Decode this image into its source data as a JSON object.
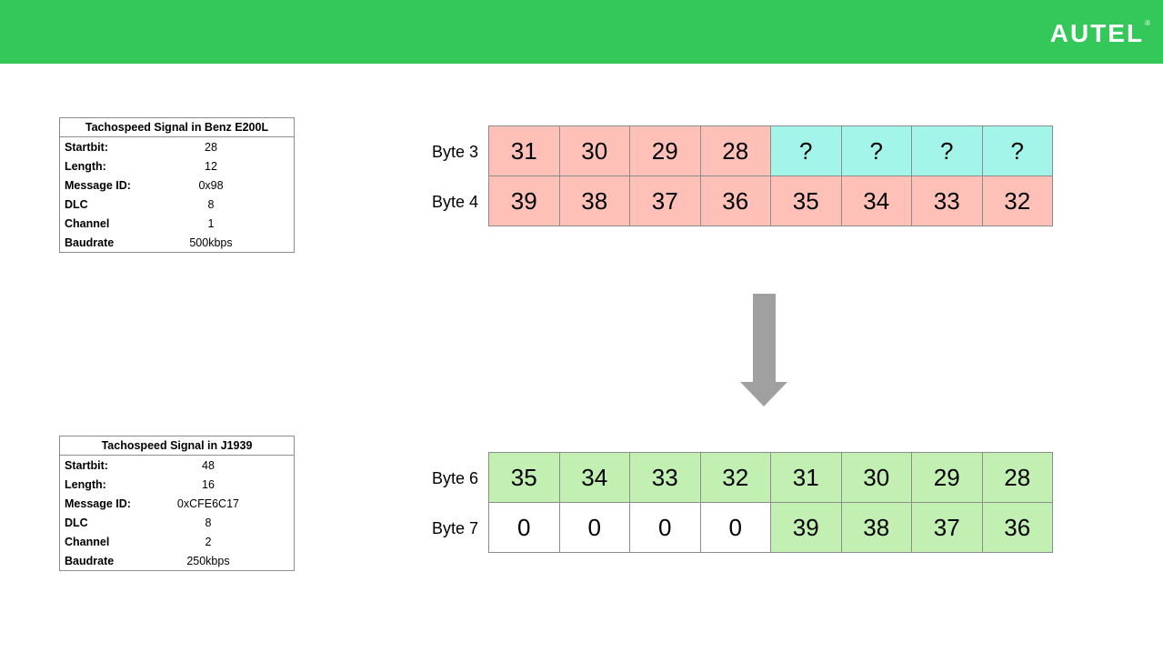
{
  "brand": {
    "logo_text": "AUTEL",
    "logo_mark": "®",
    "bar_color": "#34c759"
  },
  "table_benz": {
    "title": "Tachospeed Signal in Benz E200L",
    "rows": [
      {
        "key": "Startbit:",
        "value": "28"
      },
      {
        "key": "Length:",
        "value": "12"
      },
      {
        "key": "Message ID:",
        "value": "0x98"
      },
      {
        "key": "DLC",
        "value": "8"
      },
      {
        "key": "Channel",
        "value": "1"
      },
      {
        "key": "Baudrate",
        "value": "500kbps"
      }
    ]
  },
  "table_j1939": {
    "title": "Tachospeed Signal in J1939",
    "rows": [
      {
        "key": "Startbit:",
        "value": "48"
      },
      {
        "key": "Length:",
        "value": "16"
      },
      {
        "key": "Message ID:",
        "value": "0xCFE6C17"
      },
      {
        "key": "DLC",
        "value": "8"
      },
      {
        "key": "Channel",
        "value": "2"
      },
      {
        "key": "Baudrate",
        "value": "250kbps"
      }
    ]
  },
  "grid_benz": {
    "rows": [
      {
        "label": "Byte 3",
        "cells": [
          "31",
          "30",
          "29",
          "28",
          "?",
          "?",
          "?",
          "?"
        ],
        "colors": [
          "red",
          "red",
          "red",
          "red",
          "cyan",
          "cyan",
          "cyan",
          "cyan"
        ]
      },
      {
        "label": "Byte 4",
        "cells": [
          "39",
          "38",
          "37",
          "36",
          "35",
          "34",
          "33",
          "32"
        ],
        "colors": [
          "red",
          "red",
          "red",
          "red",
          "red",
          "red",
          "red",
          "red"
        ]
      }
    ]
  },
  "grid_j1939": {
    "rows": [
      {
        "label": "Byte 6",
        "cells": [
          "35",
          "34",
          "33",
          "32",
          "31",
          "30",
          "29",
          "28"
        ],
        "colors": [
          "green",
          "green",
          "green",
          "green",
          "green",
          "green",
          "green",
          "green"
        ]
      },
      {
        "label": "Byte 7",
        "cells": [
          "0",
          "0",
          "0",
          "0",
          "39",
          "38",
          "37",
          "36"
        ],
        "colors": [
          "white",
          "white",
          "white",
          "white",
          "green",
          "green",
          "green",
          "green"
        ]
      }
    ]
  },
  "colors": {
    "red": "#ffc1b7",
    "cyan": "#a3f5ea",
    "green": "#c2efb2",
    "arrow": "#a0a0a0"
  }
}
